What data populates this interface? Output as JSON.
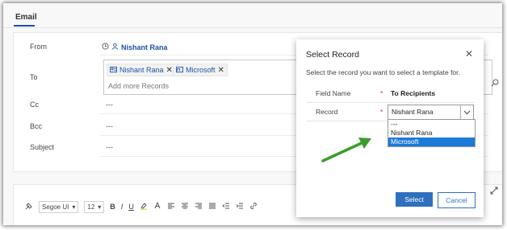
{
  "tab": {
    "label": "Email"
  },
  "form": {
    "from_label": "From",
    "from_value": "Nishant Rana",
    "to_label": "To",
    "to_chips": [
      "Nishant Rana",
      "Microsoft"
    ],
    "to_placeholder": "Add more Records",
    "cc_label": "Cc",
    "cc_value": "---",
    "bcc_label": "Bcc",
    "bcc_value": "---",
    "subject_label": "Subject",
    "subject_value": "---"
  },
  "toolbar": {
    "font": "Segoe UI",
    "size": "12",
    "bold": "B",
    "italic": "I",
    "underline": "U"
  },
  "modal": {
    "title": "Select Record",
    "subtitle": "Select the record you want to select a template for.",
    "field_name_label": "Field Name",
    "field_name_value": "To Recipients",
    "record_label": "Record",
    "required_mark": "*",
    "record_selected": "Nishant Rana",
    "options": [
      "---",
      "Nishant Rana",
      "Microsoft"
    ],
    "highlighted_option": "Microsoft",
    "select_button": "Select",
    "cancel_button": "Cancel"
  },
  "colors": {
    "accent": "#2f6fbd",
    "link": "#1d52a5",
    "arrow": "#3a9e2a",
    "highlight": "#1e7ad8"
  }
}
